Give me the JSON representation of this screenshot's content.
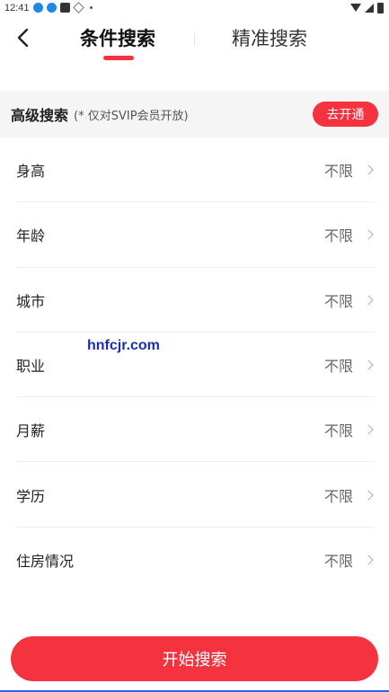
{
  "status_bar": {
    "time": "12:41"
  },
  "nav": {
    "tabs": [
      {
        "label": "条件搜索",
        "active": true
      },
      {
        "label": "精准搜索",
        "active": false
      }
    ]
  },
  "advanced": {
    "title": "高级搜索",
    "note": "(* 仅对SVIP会员开放)",
    "button_label": "去开通"
  },
  "filters": [
    {
      "label": "身高",
      "value": "不限"
    },
    {
      "label": "年龄",
      "value": "不限"
    },
    {
      "label": "城市",
      "value": "不限"
    },
    {
      "label": "职业",
      "value": "不限"
    },
    {
      "label": "月薪",
      "value": "不限"
    },
    {
      "label": "学历",
      "value": "不限"
    },
    {
      "label": "住房情况",
      "value": "不限"
    }
  ],
  "watermark": "hnfcjr.com",
  "start_button": "开始搜索",
  "colors": {
    "accent": "#f5333f",
    "background": "#ffffff",
    "section": "#f5f5f5"
  }
}
